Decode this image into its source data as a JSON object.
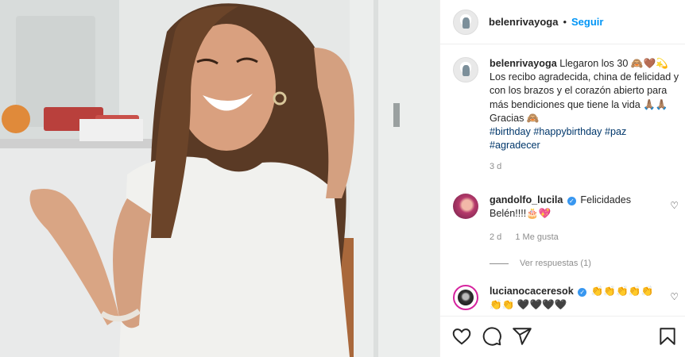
{
  "post": {
    "username": "belenrivayoga",
    "separator": "•",
    "follow_label": "Seguir"
  },
  "caption": {
    "username": "belenrivayoga",
    "text_1": "Llegaron los 30 🙈🤎💫",
    "text_2": "Los recibo agradecida, china de felicidad y con los brazos y el corazón abierto para más bendiciones que tiene la vida 🙏🏽🙏🏽",
    "text_3": "Gracias 🙈",
    "tags": [
      "#birthday",
      "#happybirthday",
      "#paz",
      "#agradecer"
    ],
    "time": "3 d"
  },
  "comments": [
    {
      "username": "gandolfo_lucila",
      "text": "Felicidades Belén!!!!🎂💖",
      "time": "2 d",
      "likes": "1 Me gusta",
      "replies": "Ver respuestas (1)"
    },
    {
      "username": "lucianocaceresok",
      "text": "👏👏👏👏👏👏👏 🖤🖤🖤🖤"
    }
  ],
  "icons": {
    "like": "heart-icon",
    "comment": "comment-icon",
    "share": "share-icon",
    "save": "bookmark-icon"
  },
  "colors": {
    "accent": "#0095f6",
    "hashtag": "#00376b",
    "muted": "#8e8e8e"
  }
}
